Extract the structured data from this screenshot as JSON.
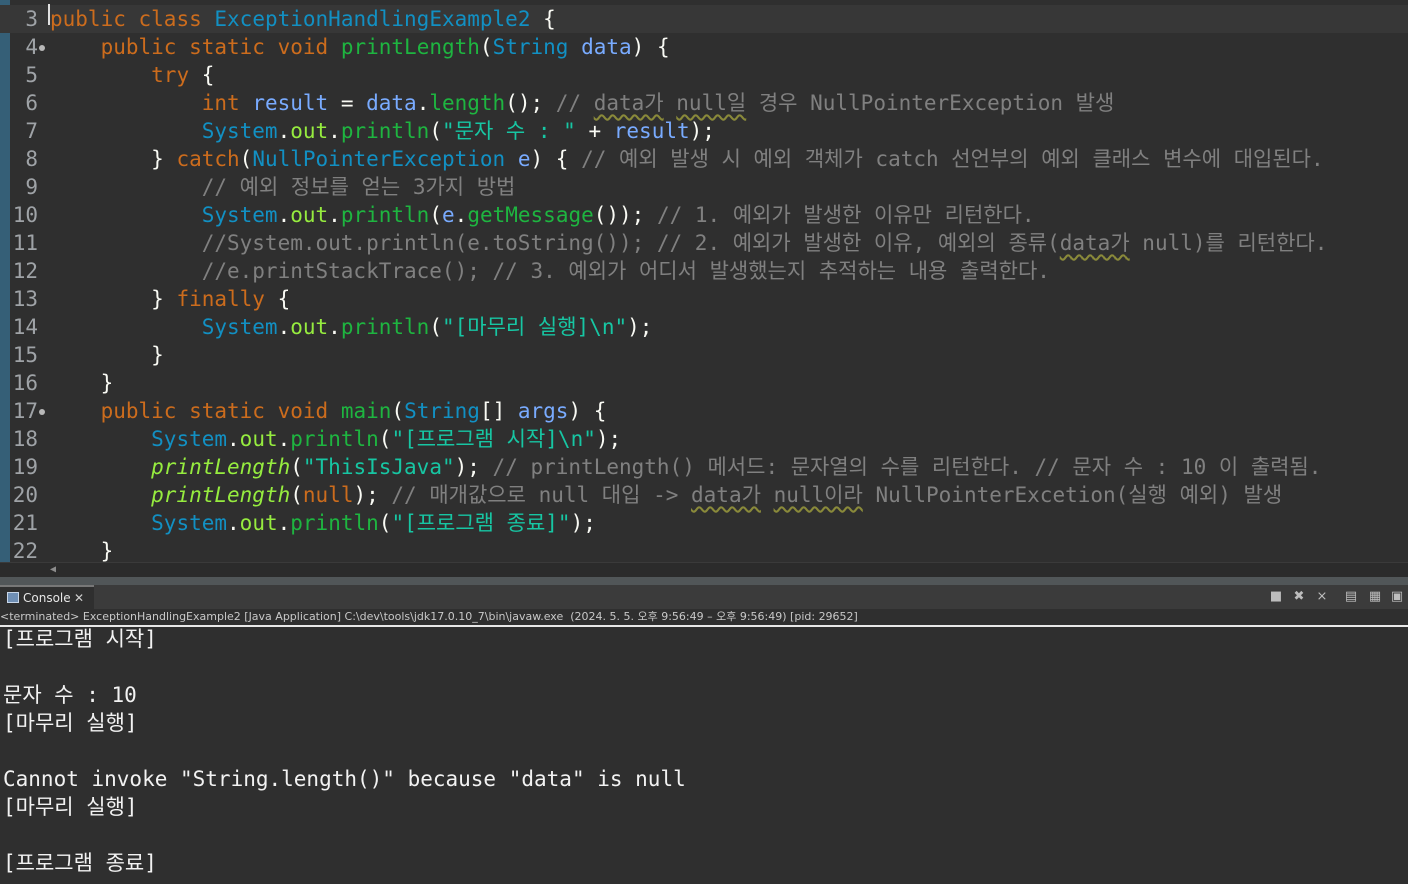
{
  "editor": {
    "lines": [
      {
        "num": "3",
        "fold": false,
        "current": true,
        "tokens": [
          [
            "kw",
            "public"
          ],
          [
            "pl",
            " "
          ],
          [
            "kw",
            "class"
          ],
          [
            "pl",
            " "
          ],
          [
            "ty",
            "ExceptionHandlingExample2"
          ],
          [
            "pl",
            " {"
          ]
        ]
      },
      {
        "num": "4",
        "fold": true,
        "current": false,
        "tokens": [
          [
            "pl",
            "    "
          ],
          [
            "kw",
            "public"
          ],
          [
            "pl",
            " "
          ],
          [
            "kw",
            "static"
          ],
          [
            "pl",
            " "
          ],
          [
            "kw",
            "void"
          ],
          [
            "pl",
            " "
          ],
          [
            "mt",
            "printLength"
          ],
          [
            "pl",
            "("
          ],
          [
            "ty",
            "String"
          ],
          [
            "pl",
            " "
          ],
          [
            "param",
            "data"
          ],
          [
            "pl",
            ") {"
          ]
        ]
      },
      {
        "num": "5",
        "fold": false,
        "current": false,
        "tokens": [
          [
            "pl",
            "        "
          ],
          [
            "kw",
            "try"
          ],
          [
            "pl",
            " {"
          ]
        ]
      },
      {
        "num": "6",
        "fold": false,
        "current": false,
        "tokens": [
          [
            "pl",
            "            "
          ],
          [
            "kw",
            "int"
          ],
          [
            "pl",
            " "
          ],
          [
            "var",
            "result"
          ],
          [
            "pl",
            " = "
          ],
          [
            "param",
            "data"
          ],
          [
            "pl",
            "."
          ],
          [
            "mt",
            "length"
          ],
          [
            "pl",
            "(); "
          ],
          [
            "cm",
            "// "
          ],
          [
            "cm sq",
            "data가"
          ],
          [
            "cm",
            " "
          ],
          [
            "cm sq",
            "null일"
          ],
          [
            "cm",
            " 경우 NullPointerException 발생"
          ]
        ]
      },
      {
        "num": "7",
        "fold": false,
        "current": false,
        "tokens": [
          [
            "pl",
            "            "
          ],
          [
            "ty",
            "System"
          ],
          [
            "pl",
            "."
          ],
          [
            "sm",
            "out"
          ],
          [
            "pl",
            "."
          ],
          [
            "mt",
            "println"
          ],
          [
            "pl",
            "("
          ],
          [
            "st",
            "\"문자 수 : \""
          ],
          [
            "pl",
            " + "
          ],
          [
            "var",
            "result"
          ],
          [
            "pl",
            ");"
          ]
        ]
      },
      {
        "num": "8",
        "fold": false,
        "current": false,
        "tokens": [
          [
            "pl",
            "        } "
          ],
          [
            "kw",
            "catch"
          ],
          [
            "pl",
            "("
          ],
          [
            "ty",
            "NullPointerException"
          ],
          [
            "pl",
            " "
          ],
          [
            "param",
            "e"
          ],
          [
            "pl",
            ") { "
          ],
          [
            "cm",
            "// 예외 발생 시 예외 객체가 catch 선언부의 예외 클래스 변수에 대입된다."
          ]
        ]
      },
      {
        "num": "9",
        "fold": false,
        "current": false,
        "tokens": [
          [
            "pl",
            "            "
          ],
          [
            "cm",
            "// 예외 정보를 얻는 3가지 방법"
          ]
        ]
      },
      {
        "num": "10",
        "fold": false,
        "current": false,
        "tokens": [
          [
            "pl",
            "            "
          ],
          [
            "ty",
            "System"
          ],
          [
            "pl",
            "."
          ],
          [
            "sm",
            "out"
          ],
          [
            "pl",
            "."
          ],
          [
            "mt",
            "println"
          ],
          [
            "pl",
            "("
          ],
          [
            "param",
            "e"
          ],
          [
            "pl",
            "."
          ],
          [
            "mt",
            "getMessage"
          ],
          [
            "pl",
            "()); "
          ],
          [
            "cm",
            "// 1. 예외가 발생한 이유만 리턴한다."
          ]
        ]
      },
      {
        "num": "11",
        "fold": false,
        "current": false,
        "tokens": [
          [
            "pl",
            "            "
          ],
          [
            "cm",
            "//System.out.println(e.toString()); // 2. 예외가 발생한 이유, 예외의 종류("
          ],
          [
            "cm sq",
            "data가"
          ],
          [
            "cm",
            " null)를 리턴한다."
          ]
        ]
      },
      {
        "num": "12",
        "fold": false,
        "current": false,
        "tokens": [
          [
            "pl",
            "            "
          ],
          [
            "cm",
            "//e.printStackTrace(); // 3. 예외가 어디서 발생했는지 추적하는 내용 출력한다."
          ]
        ]
      },
      {
        "num": "13",
        "fold": false,
        "current": false,
        "tokens": [
          [
            "pl",
            "        } "
          ],
          [
            "kw",
            "finally"
          ],
          [
            "pl",
            " {"
          ]
        ]
      },
      {
        "num": "14",
        "fold": false,
        "current": false,
        "tokens": [
          [
            "pl",
            "            "
          ],
          [
            "ty",
            "System"
          ],
          [
            "pl",
            "."
          ],
          [
            "sm",
            "out"
          ],
          [
            "pl",
            "."
          ],
          [
            "mt",
            "println"
          ],
          [
            "pl",
            "("
          ],
          [
            "st",
            "\"[마무리 실행]\\n\""
          ],
          [
            "pl",
            ");"
          ]
        ]
      },
      {
        "num": "15",
        "fold": false,
        "current": false,
        "tokens": [
          [
            "pl",
            "        }"
          ]
        ]
      },
      {
        "num": "16",
        "fold": false,
        "current": false,
        "tokens": [
          [
            "pl",
            "    }"
          ]
        ]
      },
      {
        "num": "17",
        "fold": true,
        "current": false,
        "tokens": [
          [
            "pl",
            "    "
          ],
          [
            "kw",
            "public"
          ],
          [
            "pl",
            " "
          ],
          [
            "kw",
            "static"
          ],
          [
            "pl",
            " "
          ],
          [
            "kw",
            "void"
          ],
          [
            "pl",
            " "
          ],
          [
            "mt",
            "main"
          ],
          [
            "pl",
            "("
          ],
          [
            "ty",
            "String"
          ],
          [
            "pl",
            "[] "
          ],
          [
            "param",
            "args"
          ],
          [
            "pl",
            ") {"
          ]
        ]
      },
      {
        "num": "18",
        "fold": false,
        "current": false,
        "tokens": [
          [
            "pl",
            "        "
          ],
          [
            "ty",
            "System"
          ],
          [
            "pl",
            "."
          ],
          [
            "sm",
            "out"
          ],
          [
            "pl",
            "."
          ],
          [
            "mt",
            "println"
          ],
          [
            "pl",
            "("
          ],
          [
            "st",
            "\"[프로그램 시작]\\n\""
          ],
          [
            "pl",
            ");"
          ]
        ]
      },
      {
        "num": "19",
        "fold": false,
        "current": false,
        "tokens": [
          [
            "pl",
            "        "
          ],
          [
            "st-it",
            "printLength"
          ],
          [
            "pl",
            "("
          ],
          [
            "st",
            "\"ThisIsJava\""
          ],
          [
            "pl",
            "); "
          ],
          [
            "cm",
            "// printLength() 메서드: 문자열의 수를 리턴한다. // 문자 수 : 10 이 출력됨."
          ]
        ]
      },
      {
        "num": "20",
        "fold": false,
        "current": false,
        "tokens": [
          [
            "pl",
            "        "
          ],
          [
            "st-it",
            "printLength"
          ],
          [
            "pl",
            "("
          ],
          [
            "kw",
            "null"
          ],
          [
            "pl",
            "); "
          ],
          [
            "cm",
            "// 매개값으로 null 대입 -> "
          ],
          [
            "cm sq",
            "data가"
          ],
          [
            "cm",
            " "
          ],
          [
            "cm sq",
            "null이라"
          ],
          [
            "cm",
            " NullPointerExcetion(실행 예외) 발생"
          ]
        ]
      },
      {
        "num": "21",
        "fold": false,
        "current": false,
        "tokens": [
          [
            "pl",
            "        "
          ],
          [
            "ty",
            "System"
          ],
          [
            "pl",
            "."
          ],
          [
            "sm",
            "out"
          ],
          [
            "pl",
            "."
          ],
          [
            "mt",
            "println"
          ],
          [
            "pl",
            "("
          ],
          [
            "st",
            "\"[프로그램 종료]\""
          ],
          [
            "pl",
            ");"
          ]
        ]
      },
      {
        "num": "22",
        "fold": false,
        "current": false,
        "tokens": [
          [
            "pl",
            "    }"
          ]
        ]
      }
    ]
  },
  "console": {
    "tab_label": "Console",
    "tab_close": "✕",
    "tool_icons": [
      "terminate-icon",
      "remove-launch-icon",
      "remove-all-terminated-icon",
      "scroll-lock-icon",
      "pin-console-icon",
      "display-selected-console-icon"
    ],
    "status": "<terminated> ExceptionHandlingExample2 [Java Application] C:\\dev\\tools\\jdk17.0.10_7\\bin\\javaw.exe  (2024. 5. 5. 오후 9:56:49 – 오후 9:56:49) [pid: 29652]",
    "output": [
      "[프로그램 시작]",
      "",
      "문자 수 : 10",
      "[마무리 실행]",
      "",
      "Cannot invoke \"String.length()\" because \"data\" is null",
      "[마무리 실행]",
      "",
      "[프로그램 종료]"
    ]
  }
}
